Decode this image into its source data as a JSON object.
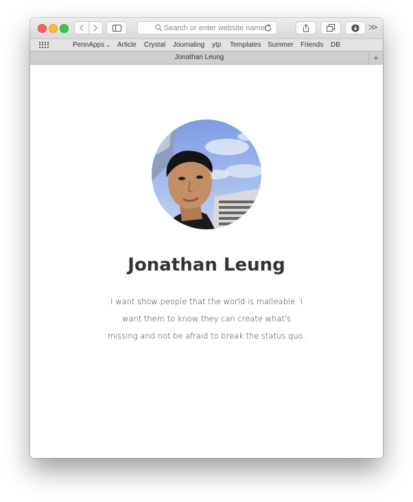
{
  "browser": {
    "address_placeholder": "Search or enter website name",
    "tab_title": "Jonathan Leung",
    "new_tab_symbol": "+",
    "overflow_symbol": ">>",
    "bookmarks": [
      "PennApps",
      "Article",
      "Crystal",
      "Journaling",
      "ytp",
      "Templates",
      "Summer",
      "Friends",
      "DB"
    ],
    "folder_chevron": "⌄"
  },
  "page": {
    "name": "Jonathan Leung",
    "bio": "I want show people that the world is malleable. I want them to know they can create what's missing and not be afraid to break the status quo."
  },
  "colors": {
    "close": "#fc5f57",
    "minimize": "#fdbc2e",
    "zoom": "#34c84a",
    "text": "#333333"
  },
  "icons": [
    "back-icon",
    "forward-icon",
    "sidebar-icon",
    "search-icon",
    "reload-icon",
    "share-icon",
    "tabs-overview-icon",
    "download-icon",
    "bookmarks-grid-icon"
  ]
}
